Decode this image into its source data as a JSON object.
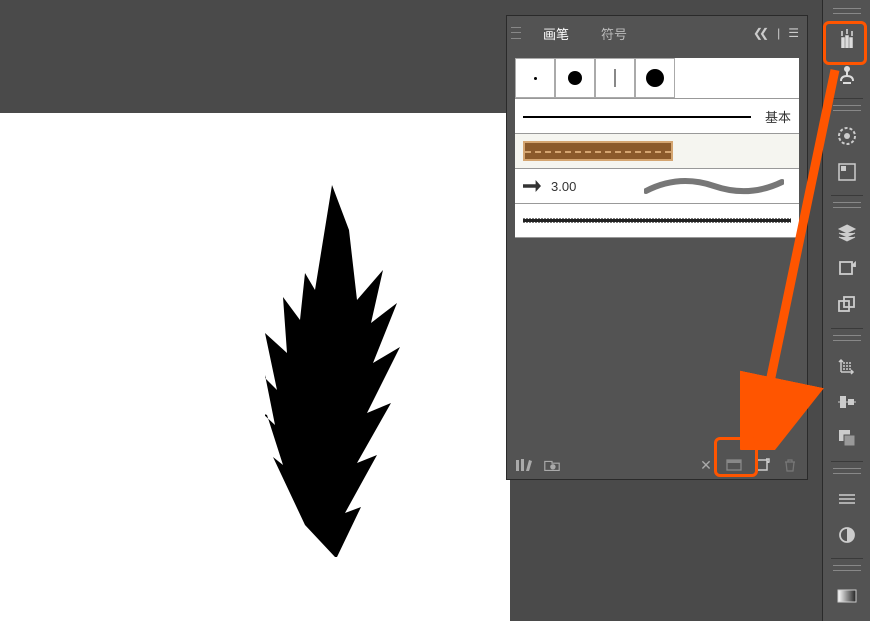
{
  "panel": {
    "tabs": {
      "brushes": "画笔",
      "symbols": "符号"
    },
    "menu_collapse": "❯❯",
    "basic_label": "基本",
    "calligraphic_value": "3.00"
  },
  "colors": {
    "highlight": "#ff5500",
    "panel_bg": "#535353",
    "canvas_bg": "#ffffff"
  }
}
